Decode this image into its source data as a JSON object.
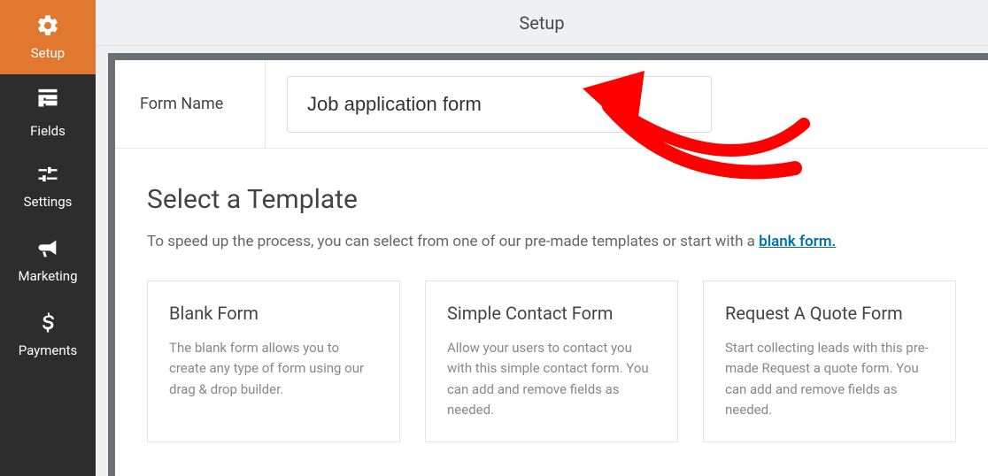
{
  "sidebar": {
    "items": [
      {
        "label": "Setup"
      },
      {
        "label": "Fields"
      },
      {
        "label": "Settings"
      },
      {
        "label": "Marketing"
      },
      {
        "label": "Payments"
      }
    ]
  },
  "topbar": {
    "title": "Setup"
  },
  "formName": {
    "label": "Form Name",
    "value": "Job application form"
  },
  "selectTemplate": {
    "heading": "Select a Template",
    "descPrefix": "To speed up the process, you can select from one of our pre-made templates or start with a ",
    "blankLink": "blank form."
  },
  "templates": [
    {
      "title": "Blank Form",
      "desc": "The blank form allows you to create any type of form using our drag & drop builder."
    },
    {
      "title": "Simple Contact Form",
      "desc": "Allow your users to contact you with this simple contact form. You can add and remove fields as needed."
    },
    {
      "title": "Request A Quote Form",
      "desc": "Start collecting leads with this pre-made Request a quote form. You can add and remove fields as needed."
    }
  ]
}
